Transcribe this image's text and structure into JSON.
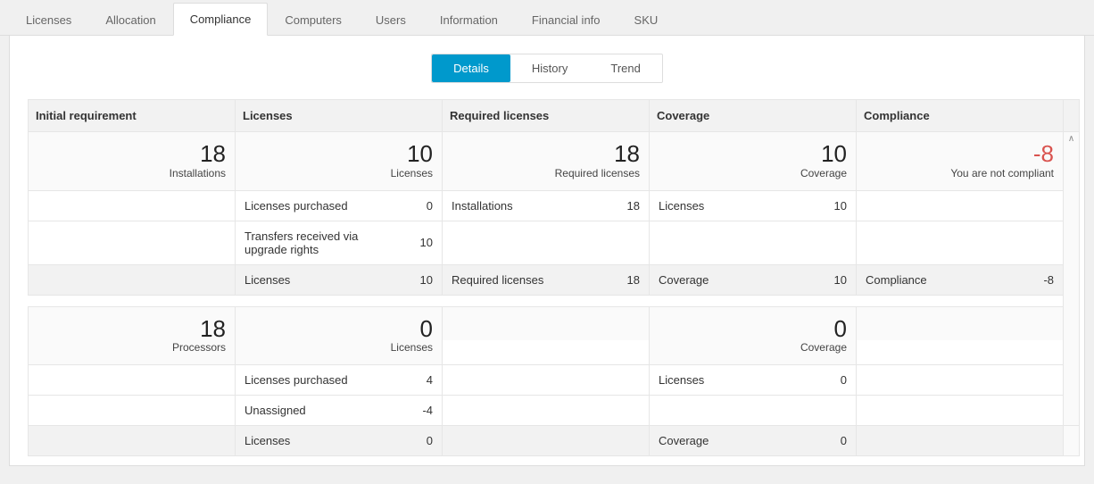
{
  "tabs": {
    "licenses": "Licenses",
    "allocation": "Allocation",
    "compliance": "Compliance",
    "computers": "Computers",
    "users": "Users",
    "information": "Information",
    "financial": "Financial info",
    "sku": "SKU"
  },
  "subtabs": {
    "details": "Details",
    "history": "History",
    "trend": "Trend"
  },
  "headers": {
    "initial": "Initial requirement",
    "licenses": "Licenses",
    "required": "Required licenses",
    "coverage": "Coverage",
    "compliance": "Compliance"
  },
  "group1": {
    "initial": {
      "value": "18",
      "label": "Installations"
    },
    "licenses": {
      "value": "10",
      "label": "Licenses",
      "rows": {
        "r1": {
          "label": "Licenses purchased",
          "value": "0"
        },
        "r2": {
          "label": "Transfers received via upgrade rights",
          "value": "10"
        },
        "total": {
          "label": "Licenses",
          "value": "10"
        }
      }
    },
    "required": {
      "value": "18",
      "label": "Required licenses",
      "rows": {
        "r1": {
          "label": "Installations",
          "value": "18"
        },
        "total": {
          "label": "Required licenses",
          "value": "18"
        }
      }
    },
    "coverage": {
      "value": "10",
      "label": "Coverage",
      "rows": {
        "r1": {
          "label": "Licenses",
          "value": "10"
        },
        "total": {
          "label": "Coverage",
          "value": "10"
        }
      }
    },
    "compliance": {
      "value": "-8",
      "label": "You are not compliant",
      "rows": {
        "total": {
          "label": "Compliance",
          "value": "-8"
        }
      }
    }
  },
  "group2": {
    "initial": {
      "value": "18",
      "label": "Processors"
    },
    "licenses": {
      "value": "0",
      "label": "Licenses",
      "rows": {
        "r1": {
          "label": "Licenses purchased",
          "value": "4"
        },
        "r2": {
          "label": "Unassigned",
          "value": "-4"
        },
        "total": {
          "label": "Licenses",
          "value": "0"
        }
      }
    },
    "coverage": {
      "value": "0",
      "label": "Coverage",
      "rows": {
        "r1": {
          "label": "Licenses",
          "value": "0"
        },
        "total": {
          "label": "Coverage",
          "value": "0"
        }
      }
    }
  }
}
